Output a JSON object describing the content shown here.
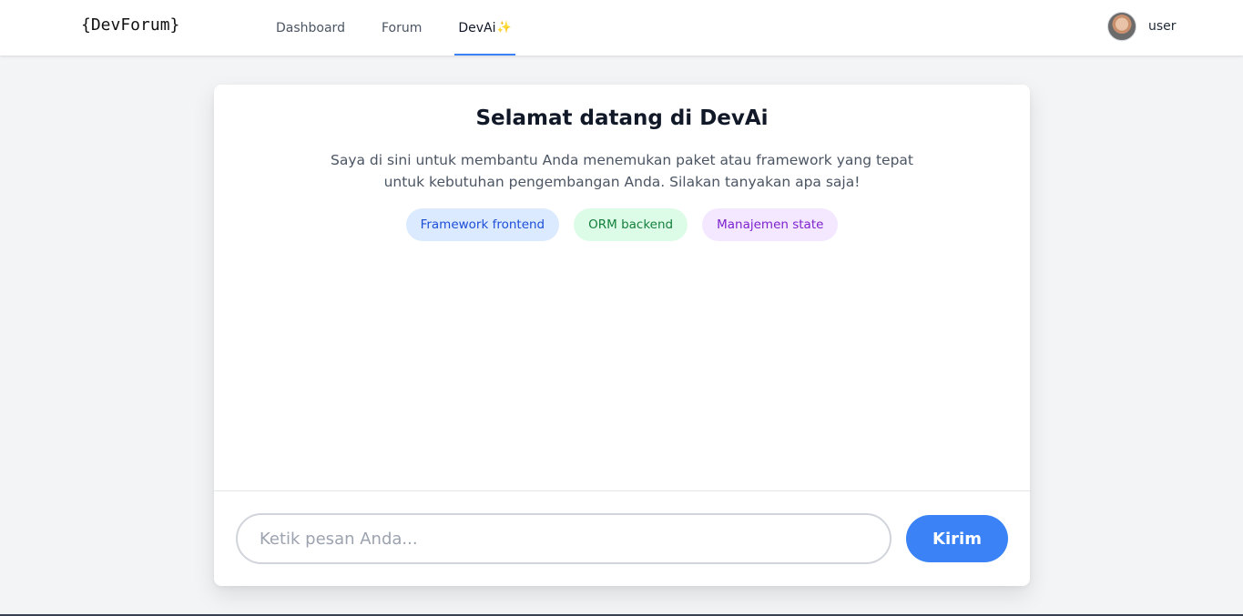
{
  "header": {
    "logo": "{DevForum}",
    "nav": [
      {
        "label": "Dashboard"
      },
      {
        "label": "Forum"
      },
      {
        "label": "DevAi",
        "suffix_icon": "✨"
      }
    ],
    "active_tab": "DevAi",
    "user_name": "user"
  },
  "chat": {
    "title": "Selamat datang di DevAi",
    "subtitle": "Saya di sini untuk membantu Anda menemukan paket atau framework yang tepat untuk kebutuhan pengembangan Anda. Silakan tanyakan apa saja!",
    "suggestions": [
      "Framework frontend",
      "ORM backend",
      "Manajemen state"
    ],
    "input_placeholder": "Ketik pesan Anda...",
    "input_value": "",
    "send_label": "Kirim"
  },
  "colors": {
    "accent": "#3b82f6",
    "chip_blue_bg": "#dbeafe",
    "chip_green_bg": "#dcfce7",
    "chip_purple_bg": "#f3e8ff"
  }
}
